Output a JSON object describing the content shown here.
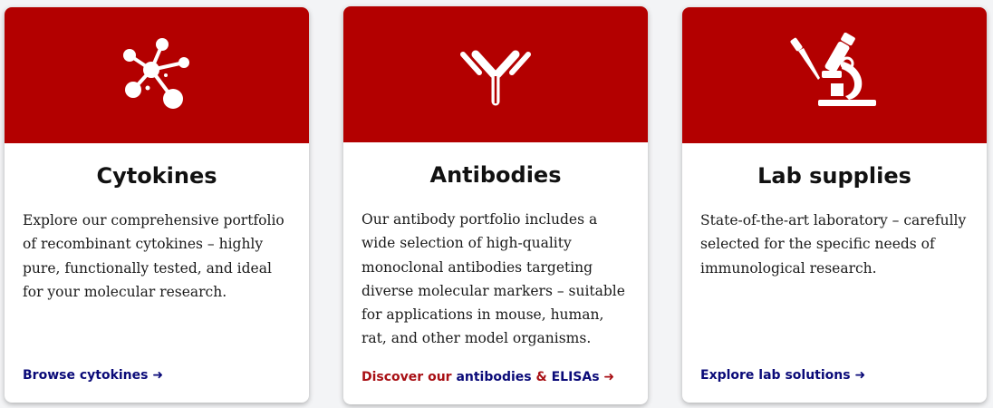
{
  "cards": [
    {
      "title": "Cytokines",
      "icon": "molecule-icon",
      "text": "Explore our comprehensive portfolio of recombinant cytokines – highly pure, functionally tested, and ideal for your molecular research.",
      "link": {
        "label": "Browse cytokines ➜"
      }
    },
    {
      "title": "Antibodies",
      "icon": "antibody-icon",
      "text": "Our antibody portfolio includes a wide selection of high-quality monoclonal antibodies targeting diverse molecular markers – suitable for applications in mouse, human, rat, and other model organisms.",
      "link": {
        "prefix": "Discover our ",
        "antibodies": "antibodies",
        "amp": " & ",
        "elisas": "ELISAs",
        "arrow": " ➜"
      }
    },
    {
      "title": "Lab supplies",
      "icon": "microscope-icon",
      "text": "State-of-the-art laboratory – carefully selected for the specific needs of immunological research.",
      "link": {
        "label": "Explore lab solutions ➜"
      }
    }
  ],
  "colors": {
    "header_red": "#b30000",
    "link_navy": "#0a0a78",
    "link_red": "#a80f14",
    "page_bg": "#f3f4f6"
  }
}
